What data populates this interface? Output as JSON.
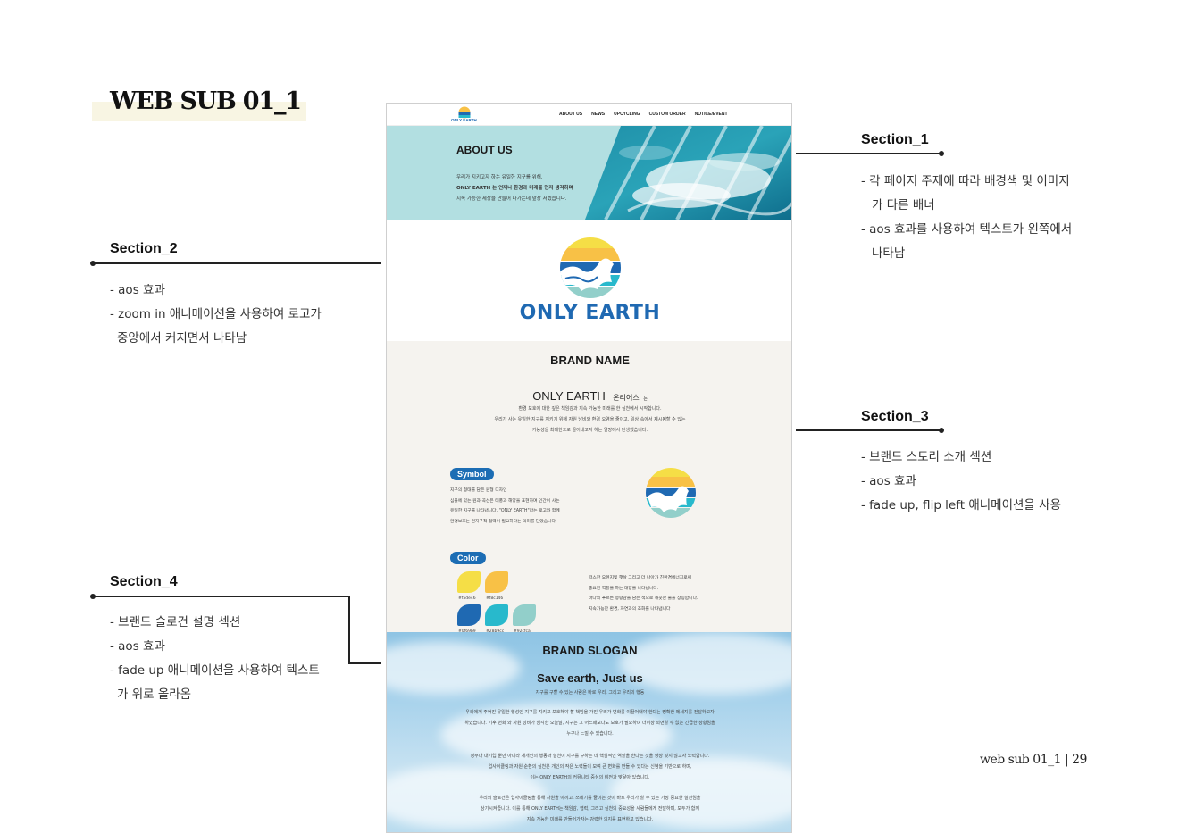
{
  "page_title": "WEB SUB 01_1",
  "footer": "web sub 01_1  |  29",
  "annotations": {
    "section1": {
      "title": "Section_1",
      "lines": [
        "- 각 페이지 주제에 따라 배경색 및 이미지",
        "  가 다른 배너",
        "- aos 효과를 사용하여 텍스트가 왼쪽에서",
        "  나타남"
      ]
    },
    "section2": {
      "title": "Section_2",
      "lines": [
        "- aos 효과",
        "- zoom in 애니메이션을 사용하여 로고가",
        "  중앙에서 커지면서 나타남"
      ]
    },
    "section3": {
      "title": "Section_3",
      "lines": [
        "- 브랜드 스토리 소개 섹션",
        "- aos 효과",
        "- fade up, flip left 애니메이션을 사용"
      ]
    },
    "section4": {
      "title": "Section_4",
      "lines": [
        "- 브랜드 슬로건 설명 섹션",
        "- aos 효과",
        "- fade up 애니메이션을 사용하여 텍스트",
        "  가 위로 올라옴"
      ]
    }
  },
  "mockup": {
    "nav": [
      "ABOUT US",
      "NEWS",
      "UPCYCLING",
      "CUSTOM ORDER",
      "NOTICE/EVENT"
    ],
    "logo_small_text": "ONLY EARTH",
    "about": {
      "title": "ABOUT US",
      "lines": [
        "우리가 지키고자 하는 유일한 지구를 위해,",
        "ONLY EARTH 는 언제나 환경과 미래를 먼저 생각하며",
        "지속 가능한 세상을 만들어 나가는데 앞장 서겠습니다."
      ]
    },
    "logo_text": "ONLY EARTH",
    "brand_name": {
      "title": "BRAND NAME",
      "name": "ONLY EARTH",
      "pronounce": "온리어스",
      "particle": "는",
      "lines": [
        "환경 보호에 대한 깊은 책임감과 지속 가능한 미래를 한 실천에서 시작합니다.",
        "우리가 사는 유일한 지구를 지키기 위해 자원 낭비와 환경 오염을 줄이고, 일상 속에서 제시됨할 수 있는",
        "가능성을 최대한으로 끌어내고자 하는 열망에서 탄생했습니다."
      ],
      "symbol_label": "Symbol",
      "symbol_lines": [
        "지구의 형태를 담은 원형 디자인",
        "심볼에 있는 원과 곡선은 태풍과 해양을 표현하며 인간이 사는",
        "유일한 지구를 나타냅니다. \"ONLY EARTH\"라는 로고와 함께",
        "환경보호는 전지구적 협력이 필요하다는 의미를 담았습니다."
      ],
      "color_label": "Color",
      "colors": [
        {
          "hex": "#f5de46",
          "label": "#f5de46"
        },
        {
          "hex": "#f8c146",
          "label": "#f8c146"
        },
        {
          "hex": "#1f69b2",
          "label": "#0f69b9"
        },
        {
          "hex": "#28b9cc",
          "label": "#28b9cc"
        },
        {
          "hex": "#92cfca",
          "label": "#92cfca"
        }
      ],
      "color_lines": [
        "떠스한 오렌지빛 햇살 그리고 더 나아가 친환경에너지로써",
        "중요한 역할을 하는 태양을 나타냅니다.",
        "바다의 푸르른 청량감을 담은 색으로 깨끗한 물을 상징합니다.",
        "지속가능한 환경, 자연과의 조화를 나타냅니다"
      ]
    },
    "slogan": {
      "title": "BRAND SLOGAN",
      "headline": "Save earth, Just us",
      "sub": "지구를 구할 수 있는 사람은 바로 우리, 그리고 우리의 행동",
      "para1": [
        "우리에게 주어진 유일한 행성인 지구를 지키고 보호해야 할 책임을 가진 우리가 변화를 이끌어내야 한다는 명확한 메세지를 전달하고자",
        "하였습니다.  기후 변화 와 자원 낭비가 심각한 오늘날, 지구는 그 어느때보다도 보호가 필요하며 더이상 외면할 수 없는 긴급한 상황임을",
        "누구나 느낄 수 있습니다."
      ],
      "para2": [
        "정부나 대기업 뿐만 아니라 개개인의 행동과 실천이 지구를 구하는 데 핵심적인 역할을 한다는 것을 항상 잊지 않고자 노력합니다.",
        "업사이클링과 자원 순환의 실천은 개인의 작은 노력들이 모여 큰 변화를 만들 수 있다는 신념을 기반으로 하며,",
        "이는 ONLY EARTH의 커뮤니티 중심의 비전과 맞닿아 있습니다."
      ],
      "para3": [
        "우리의 슬로건은 업사이클링을 통해 자원을 아끼고, 쓰레기를 줄이는 것이 바로 우리가 할 수 있는 가장 중요한 실천임을",
        "상기시켜줍니다. 이를 통해 ONLY EARTH는 책임감, 협력, 그리고 실천의 중요성을 사람들에게 전달하며, 모두가 함께",
        "지속 가능한 미래를 만들어가자는 강력한 의지를 표현하고 있습니다."
      ]
    }
  }
}
